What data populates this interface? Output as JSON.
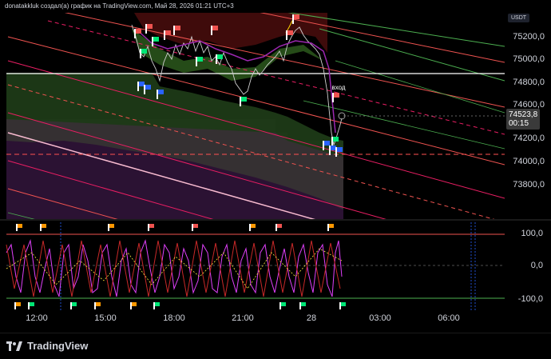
{
  "header": {
    "text": "donatakkluk создал(а) график на TradingView.com, Май 28, 2026 01:21 UTC+3"
  },
  "currency": "USDT",
  "current_price": {
    "value": "74523,8",
    "countdown": "00:15"
  },
  "annotation": "вход",
  "price_axis": {
    "labels": [
      "75200,0",
      "75000,0",
      "74800,0",
      "74600,0",
      "74400,0",
      "74200,0",
      "74000,0",
      "73800,0"
    ]
  },
  "oscillator_axis": {
    "labels": [
      "100,0",
      "0,0",
      "-100,0"
    ]
  },
  "time_axis": {
    "labels": [
      "12:00",
      "15:00",
      "18:00",
      "21:00",
      "28",
      "03:00",
      "06:00"
    ]
  },
  "footer": {
    "brand": "TradingView"
  },
  "colors": {
    "background": "#000000",
    "bull_cloud": "#1b5e20",
    "bear_cloud": "#4a148c",
    "gray_zone": "#4a4a4a",
    "channel_red": "#ef5350",
    "channel_pink": "#e91e63",
    "channel_green": "#4caf50",
    "horizontal_line": "#ffffff",
    "dashed_red": "#ff5252"
  },
  "icons": [
    "red-flag-icon",
    "green-flag-icon",
    "blue-flag-icon",
    "orange-flag-icon",
    "tradingview-logo-icon"
  ]
}
